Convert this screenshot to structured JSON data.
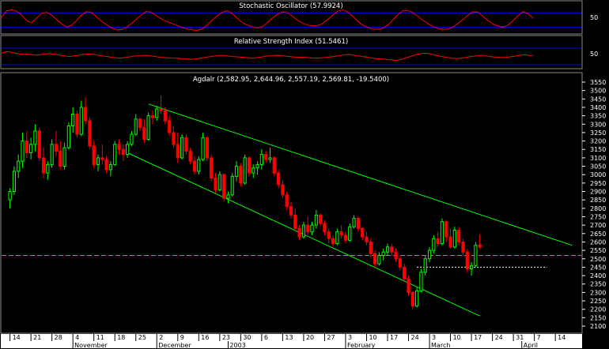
{
  "chart_data": [
    {
      "type": "line",
      "title": "Stochastic Oscillator (57.9924)",
      "y_ticks": [
        "50"
      ],
      "ylim": [
        0,
        100
      ],
      "reference_levels": [
        80,
        20
      ],
      "values": [
        62,
        88,
        92,
        86,
        70,
        48,
        40,
        58,
        78,
        82,
        70,
        52,
        34,
        22,
        30,
        50,
        72,
        85,
        80,
        62,
        45,
        30,
        18,
        10,
        12,
        22,
        38,
        56,
        74,
        86,
        80,
        66,
        54,
        44,
        36,
        28,
        20,
        14,
        10,
        8,
        14,
        30,
        50,
        68,
        82,
        88,
        76,
        58,
        40,
        30,
        22,
        18,
        24,
        40,
        58,
        74,
        84,
        80,
        66,
        50,
        38,
        30,
        26,
        28,
        36,
        52,
        70,
        86,
        92,
        84,
        66,
        46,
        30,
        20,
        14,
        12,
        16,
        30,
        50,
        72,
        88,
        90,
        80,
        66,
        50,
        36,
        24,
        16,
        12,
        14,
        22,
        36,
        52,
        70,
        84,
        82,
        66,
        48,
        34,
        26,
        22,
        30,
        48,
        68,
        84,
        76,
        58
      ],
      "colors": {
        "line": "#ff0000",
        "levels": "#0000ff"
      }
    },
    {
      "type": "line",
      "title": "Relative Strength Index (51.5461)",
      "y_ticks": [
        "50"
      ],
      "ylim": [
        20,
        80
      ],
      "reference_levels": [
        70,
        30
      ],
      "values": [
        58,
        62,
        60,
        57,
        55,
        56,
        54,
        53,
        55,
        57,
        56,
        54,
        52,
        50,
        51,
        53,
        55,
        56,
        55,
        53,
        51,
        49,
        47,
        46,
        47,
        49,
        51,
        52,
        53,
        52,
        50,
        48,
        47,
        46,
        46,
        45,
        44,
        43,
        44,
        46,
        48,
        50,
        52,
        53,
        52,
        50,
        49,
        48,
        47,
        46,
        47,
        49,
        51,
        52,
        53,
        52,
        50,
        49,
        48,
        48,
        47,
        46,
        46,
        47,
        48,
        50,
        52,
        54,
        55,
        53,
        51,
        49,
        47,
        45,
        44,
        43,
        42,
        40,
        42,
        46,
        50,
        54,
        57,
        58,
        56,
        53,
        50,
        48,
        46,
        45,
        46,
        48,
        50,
        52,
        53,
        51,
        49,
        48,
        47,
        48,
        50,
        52,
        54,
        53,
        52
      ],
      "colors": {
        "line": "#ff0000",
        "levels": "#0000ff"
      }
    },
    {
      "type": "candlestick",
      "title": "Agdalr (2,582.95, 2,644.96, 2,557.19, 2,569.81, -19.5400)",
      "ylim": [
        2100,
        3550
      ],
      "y_ticks": [
        "3550",
        "3500",
        "3450",
        "3400",
        "3350",
        "3300",
        "3250",
        "3200",
        "3150",
        "3100",
        "3050",
        "3000",
        "2950",
        "2900",
        "2850",
        "2800",
        "2750",
        "2700",
        "2650",
        "2600",
        "2550",
        "2500",
        "2450",
        "2400",
        "2350",
        "2300",
        "2250",
        "2200",
        "2150",
        "2100"
      ],
      "x_ticks": [
        {
          "label": "14",
          "x": 0
        },
        {
          "label": "21",
          "x": 5
        },
        {
          "label": "28",
          "x": 10
        },
        {
          "label": "4",
          "x": 15
        },
        {
          "label": "11",
          "x": 20
        },
        {
          "label": "18",
          "x": 25
        },
        {
          "label": "25",
          "x": 30
        },
        {
          "label": "2",
          "x": 35
        },
        {
          "label": "9",
          "x": 40
        },
        {
          "label": "16",
          "x": 45
        },
        {
          "label": "23",
          "x": 50
        },
        {
          "label": "30",
          "x": 55
        },
        {
          "label": "6",
          "x": 60
        },
        {
          "label": "13",
          "x": 65
        },
        {
          "label": "20",
          "x": 70
        },
        {
          "label": "27",
          "x": 75
        },
        {
          "label": "3",
          "x": 80
        },
        {
          "label": "10",
          "x": 85
        },
        {
          "label": "17",
          "x": 90
        },
        {
          "label": "24",
          "x": 95
        },
        {
          "label": "3",
          "x": 100
        },
        {
          "label": "10",
          "x": 105
        },
        {
          "label": "17",
          "x": 110
        },
        {
          "label": "24",
          "x": 115
        },
        {
          "label": "31",
          "x": 120
        },
        {
          "label": "7",
          "x": 125
        },
        {
          "label": "14",
          "x": 130
        }
      ],
      "x_month_labels": [
        {
          "label": "November",
          "x": 15
        },
        {
          "label": "December",
          "x": 35
        },
        {
          "label": "2003",
          "x": 52
        },
        {
          "label": "February",
          "x": 80
        },
        {
          "label": "March",
          "x": 100
        },
        {
          "label": "April",
          "x": 122
        }
      ],
      "x_range": [
        -2,
        136
      ],
      "candles": [
        [
          2850,
          2920,
          2800,
          2900
        ],
        [
          2900,
          3050,
          2880,
          3020
        ],
        [
          3020,
          3120,
          2980,
          3080
        ],
        [
          3080,
          3250,
          3040,
          3200
        ],
        [
          3200,
          3260,
          3100,
          3130
        ],
        [
          3130,
          3220,
          3090,
          3180
        ],
        [
          3180,
          3300,
          3140,
          3260
        ],
        [
          3260,
          3280,
          3080,
          3100
        ],
        [
          3100,
          3160,
          2980,
          3010
        ],
        [
          3010,
          3080,
          2970,
          3060
        ],
        [
          3060,
          3210,
          3040,
          3180
        ],
        [
          3180,
          3260,
          3110,
          3140
        ],
        [
          3140,
          3200,
          3030,
          3050
        ],
        [
          3050,
          3190,
          3030,
          3160
        ],
        [
          3160,
          3310,
          3150,
          3290
        ],
        [
          3290,
          3400,
          3250,
          3360
        ],
        [
          3360,
          3380,
          3220,
          3240
        ],
        [
          3240,
          3440,
          3230,
          3400
        ],
        [
          3400,
          3460,
          3300,
          3320
        ],
        [
          3320,
          3340,
          3150,
          3170
        ],
        [
          3170,
          3200,
          3040,
          3060
        ],
        [
          3060,
          3120,
          3020,
          3100
        ],
        [
          3100,
          3180,
          3060,
          3090
        ],
        [
          3090,
          3110,
          3010,
          3030
        ],
        [
          3030,
          3080,
          2990,
          3060
        ],
        [
          3060,
          3200,
          3050,
          3180
        ],
        [
          3180,
          3210,
          3120,
          3150
        ],
        [
          3150,
          3180,
          3080,
          3120
        ],
        [
          3120,
          3200,
          3100,
          3180
        ],
        [
          3180,
          3260,
          3170,
          3240
        ],
        [
          3240,
          3360,
          3230,
          3330
        ],
        [
          3330,
          3340,
          3260,
          3280
        ],
        [
          3280,
          3330,
          3190,
          3210
        ],
        [
          3210,
          3370,
          3200,
          3350
        ],
        [
          3350,
          3380,
          3300,
          3340
        ],
        [
          3340,
          3410,
          3320,
          3390
        ],
        [
          3390,
          3470,
          3360,
          3380
        ],
        [
          3380,
          3400,
          3300,
          3320
        ],
        [
          3320,
          3350,
          3230,
          3250
        ],
        [
          3250,
          3290,
          3160,
          3180
        ],
        [
          3180,
          3250,
          3070,
          3100
        ],
        [
          3100,
          3240,
          3090,
          3220
        ],
        [
          3220,
          3240,
          3120,
          3140
        ],
        [
          3140,
          3160,
          3060,
          3080
        ],
        [
          3080,
          3110,
          3000,
          3020
        ],
        [
          3020,
          3110,
          3000,
          3090
        ],
        [
          3090,
          3250,
          3080,
          3220
        ],
        [
          3220,
          3230,
          3080,
          3100
        ],
        [
          3100,
          3120,
          2960,
          2980
        ],
        [
          2980,
          3010,
          2890,
          2910
        ],
        [
          2910,
          3020,
          2900,
          3000
        ],
        [
          3000,
          3010,
          2840,
          2860
        ],
        [
          2860,
          2900,
          2830,
          2880
        ],
        [
          2880,
          3010,
          2870,
          2990
        ],
        [
          2990,
          3080,
          2960,
          3050
        ],
        [
          3050,
          3070,
          2930,
          2950
        ],
        [
          2950,
          3120,
          2940,
          3100
        ],
        [
          3100,
          3110,
          2990,
          3010
        ],
        [
          3010,
          3060,
          2980,
          3040
        ],
        [
          3040,
          3080,
          3000,
          3060
        ],
        [
          3060,
          3150,
          3030,
          3120
        ],
        [
          3120,
          3140,
          3070,
          3090
        ],
        [
          3090,
          3160,
          3070,
          3100
        ],
        [
          3100,
          3110,
          2990,
          3010
        ],
        [
          3010,
          3030,
          2920,
          2940
        ],
        [
          2940,
          2970,
          2860,
          2880
        ],
        [
          2880,
          2900,
          2790,
          2810
        ],
        [
          2810,
          2840,
          2740,
          2760
        ],
        [
          2760,
          2800,
          2660,
          2680
        ],
        [
          2680,
          2700,
          2610,
          2630
        ],
        [
          2630,
          2720,
          2620,
          2700
        ],
        [
          2700,
          2750,
          2640,
          2660
        ],
        [
          2660,
          2720,
          2640,
          2700
        ],
        [
          2700,
          2790,
          2680,
          2760
        ],
        [
          2760,
          2770,
          2690,
          2710
        ],
        [
          2710,
          2730,
          2640,
          2660
        ],
        [
          2660,
          2680,
          2590,
          2620
        ],
        [
          2620,
          2640,
          2570,
          2590
        ],
        [
          2590,
          2680,
          2580,
          2660
        ],
        [
          2660,
          2700,
          2620,
          2640
        ],
        [
          2640,
          2660,
          2590,
          2610
        ],
        [
          2610,
          2710,
          2600,
          2690
        ],
        [
          2690,
          2760,
          2680,
          2740
        ],
        [
          2740,
          2750,
          2660,
          2680
        ],
        [
          2680,
          2690,
          2610,
          2630
        ],
        [
          2630,
          2660,
          2580,
          2600
        ],
        [
          2600,
          2620,
          2510,
          2530
        ],
        [
          2530,
          2550,
          2450,
          2470
        ],
        [
          2470,
          2540,
          2460,
          2520
        ],
        [
          2520,
          2560,
          2490,
          2540
        ],
        [
          2540,
          2590,
          2520,
          2570
        ],
        [
          2570,
          2590,
          2520,
          2540
        ],
        [
          2540,
          2560,
          2480,
          2500
        ],
        [
          2500,
          2520,
          2430,
          2450
        ],
        [
          2450,
          2470,
          2360,
          2380
        ],
        [
          2380,
          2400,
          2280,
          2300
        ],
        [
          2300,
          2310,
          2200,
          2220
        ],
        [
          2220,
          2330,
          2210,
          2310
        ],
        [
          2310,
          2440,
          2300,
          2420
        ],
        [
          2420,
          2520,
          2400,
          2500
        ],
        [
          2500,
          2570,
          2480,
          2550
        ],
        [
          2550,
          2640,
          2530,
          2620
        ],
        [
          2620,
          2660,
          2570,
          2590
        ],
        [
          2590,
          2740,
          2580,
          2720
        ],
        [
          2720,
          2730,
          2600,
          2630
        ],
        [
          2630,
          2680,
          2560,
          2570
        ],
        [
          2570,
          2690,
          2560,
          2670
        ],
        [
          2670,
          2690,
          2580,
          2600
        ],
        [
          2600,
          2620,
          2520,
          2540
        ],
        [
          2540,
          2560,
          2420,
          2440
        ],
        [
          2440,
          2480,
          2400,
          2460
        ],
        [
          2460,
          2600,
          2450,
          2580
        ],
        [
          2583,
          2645,
          2557,
          2570
        ]
      ],
      "trendlines": [
        {
          "from": [
            33,
            3420
          ],
          "to": [
            134,
            2580
          ]
        },
        {
          "from": [
            28,
            3130
          ],
          "to": [
            112,
            2160
          ]
        }
      ],
      "reference_lines": [
        {
          "type": "horizontal-dashed",
          "value": 2520,
          "color": "#00c0c0"
        },
        {
          "type": "horizontal-dotted",
          "from_x": 97,
          "to_x": 128,
          "value": 2450,
          "color": "#ffffff"
        }
      ],
      "colors": {
        "up": "#00ff00",
        "down": "#ff0000",
        "trendline": "#00ff00",
        "grid": "#ffffff"
      }
    }
  ]
}
